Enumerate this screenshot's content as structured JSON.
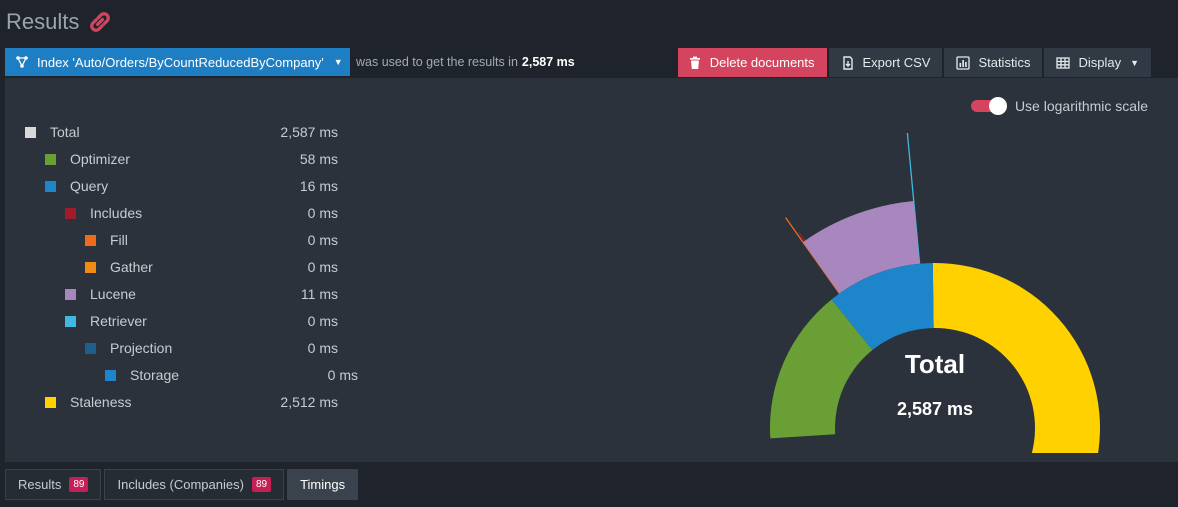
{
  "header": {
    "title": "Results"
  },
  "toolbar": {
    "index_label": "Index 'Auto/Orders/ByCountReducedByCompany'",
    "used_text": "was used to get the results in",
    "used_time": "2,587 ms",
    "delete_label": "Delete documents",
    "export_label": "Export CSV",
    "statistics_label": "Statistics",
    "display_label": "Display"
  },
  "log_scale_label": "Use logarithmic scale",
  "timings": [
    {
      "name": "Total",
      "value": "2,587 ms",
      "level": 0,
      "color": "#d9d9d9"
    },
    {
      "name": "Optimizer",
      "value": "58 ms",
      "level": 1,
      "color": "#6a9f35"
    },
    {
      "name": "Query",
      "value": "16 ms",
      "level": 1,
      "color": "#1d86cb"
    },
    {
      "name": "Includes",
      "value": "0 ms",
      "level": 2,
      "color": "#a01c2b"
    },
    {
      "name": "Fill",
      "value": "0 ms",
      "level": 3,
      "color": "#f06a1c"
    },
    {
      "name": "Gather",
      "value": "0 ms",
      "level": 3,
      "color": "#f08a14"
    },
    {
      "name": "Lucene",
      "value": "11 ms",
      "level": 2,
      "color": "#a887bf"
    },
    {
      "name": "Retriever",
      "value": "0 ms",
      "level": 2,
      "color": "#3fb8e3"
    },
    {
      "name": "Projection",
      "value": "0 ms",
      "level": 3,
      "color": "#1b5f8a"
    },
    {
      "name": "Storage",
      "value": "0 ms",
      "level": 4,
      "color": "#1d86cb"
    },
    {
      "name": "Staleness",
      "value": "2,512 ms",
      "level": 1,
      "color": "#ffd100"
    }
  ],
  "gauge": {
    "label": "Total",
    "value": "2,587 ms"
  },
  "tabs": [
    {
      "label": "Results",
      "badge": "89",
      "active": false
    },
    {
      "label": "Includes (Companies)",
      "badge": "89",
      "active": false
    },
    {
      "label": "Timings",
      "badge": "",
      "active": true
    }
  ]
}
